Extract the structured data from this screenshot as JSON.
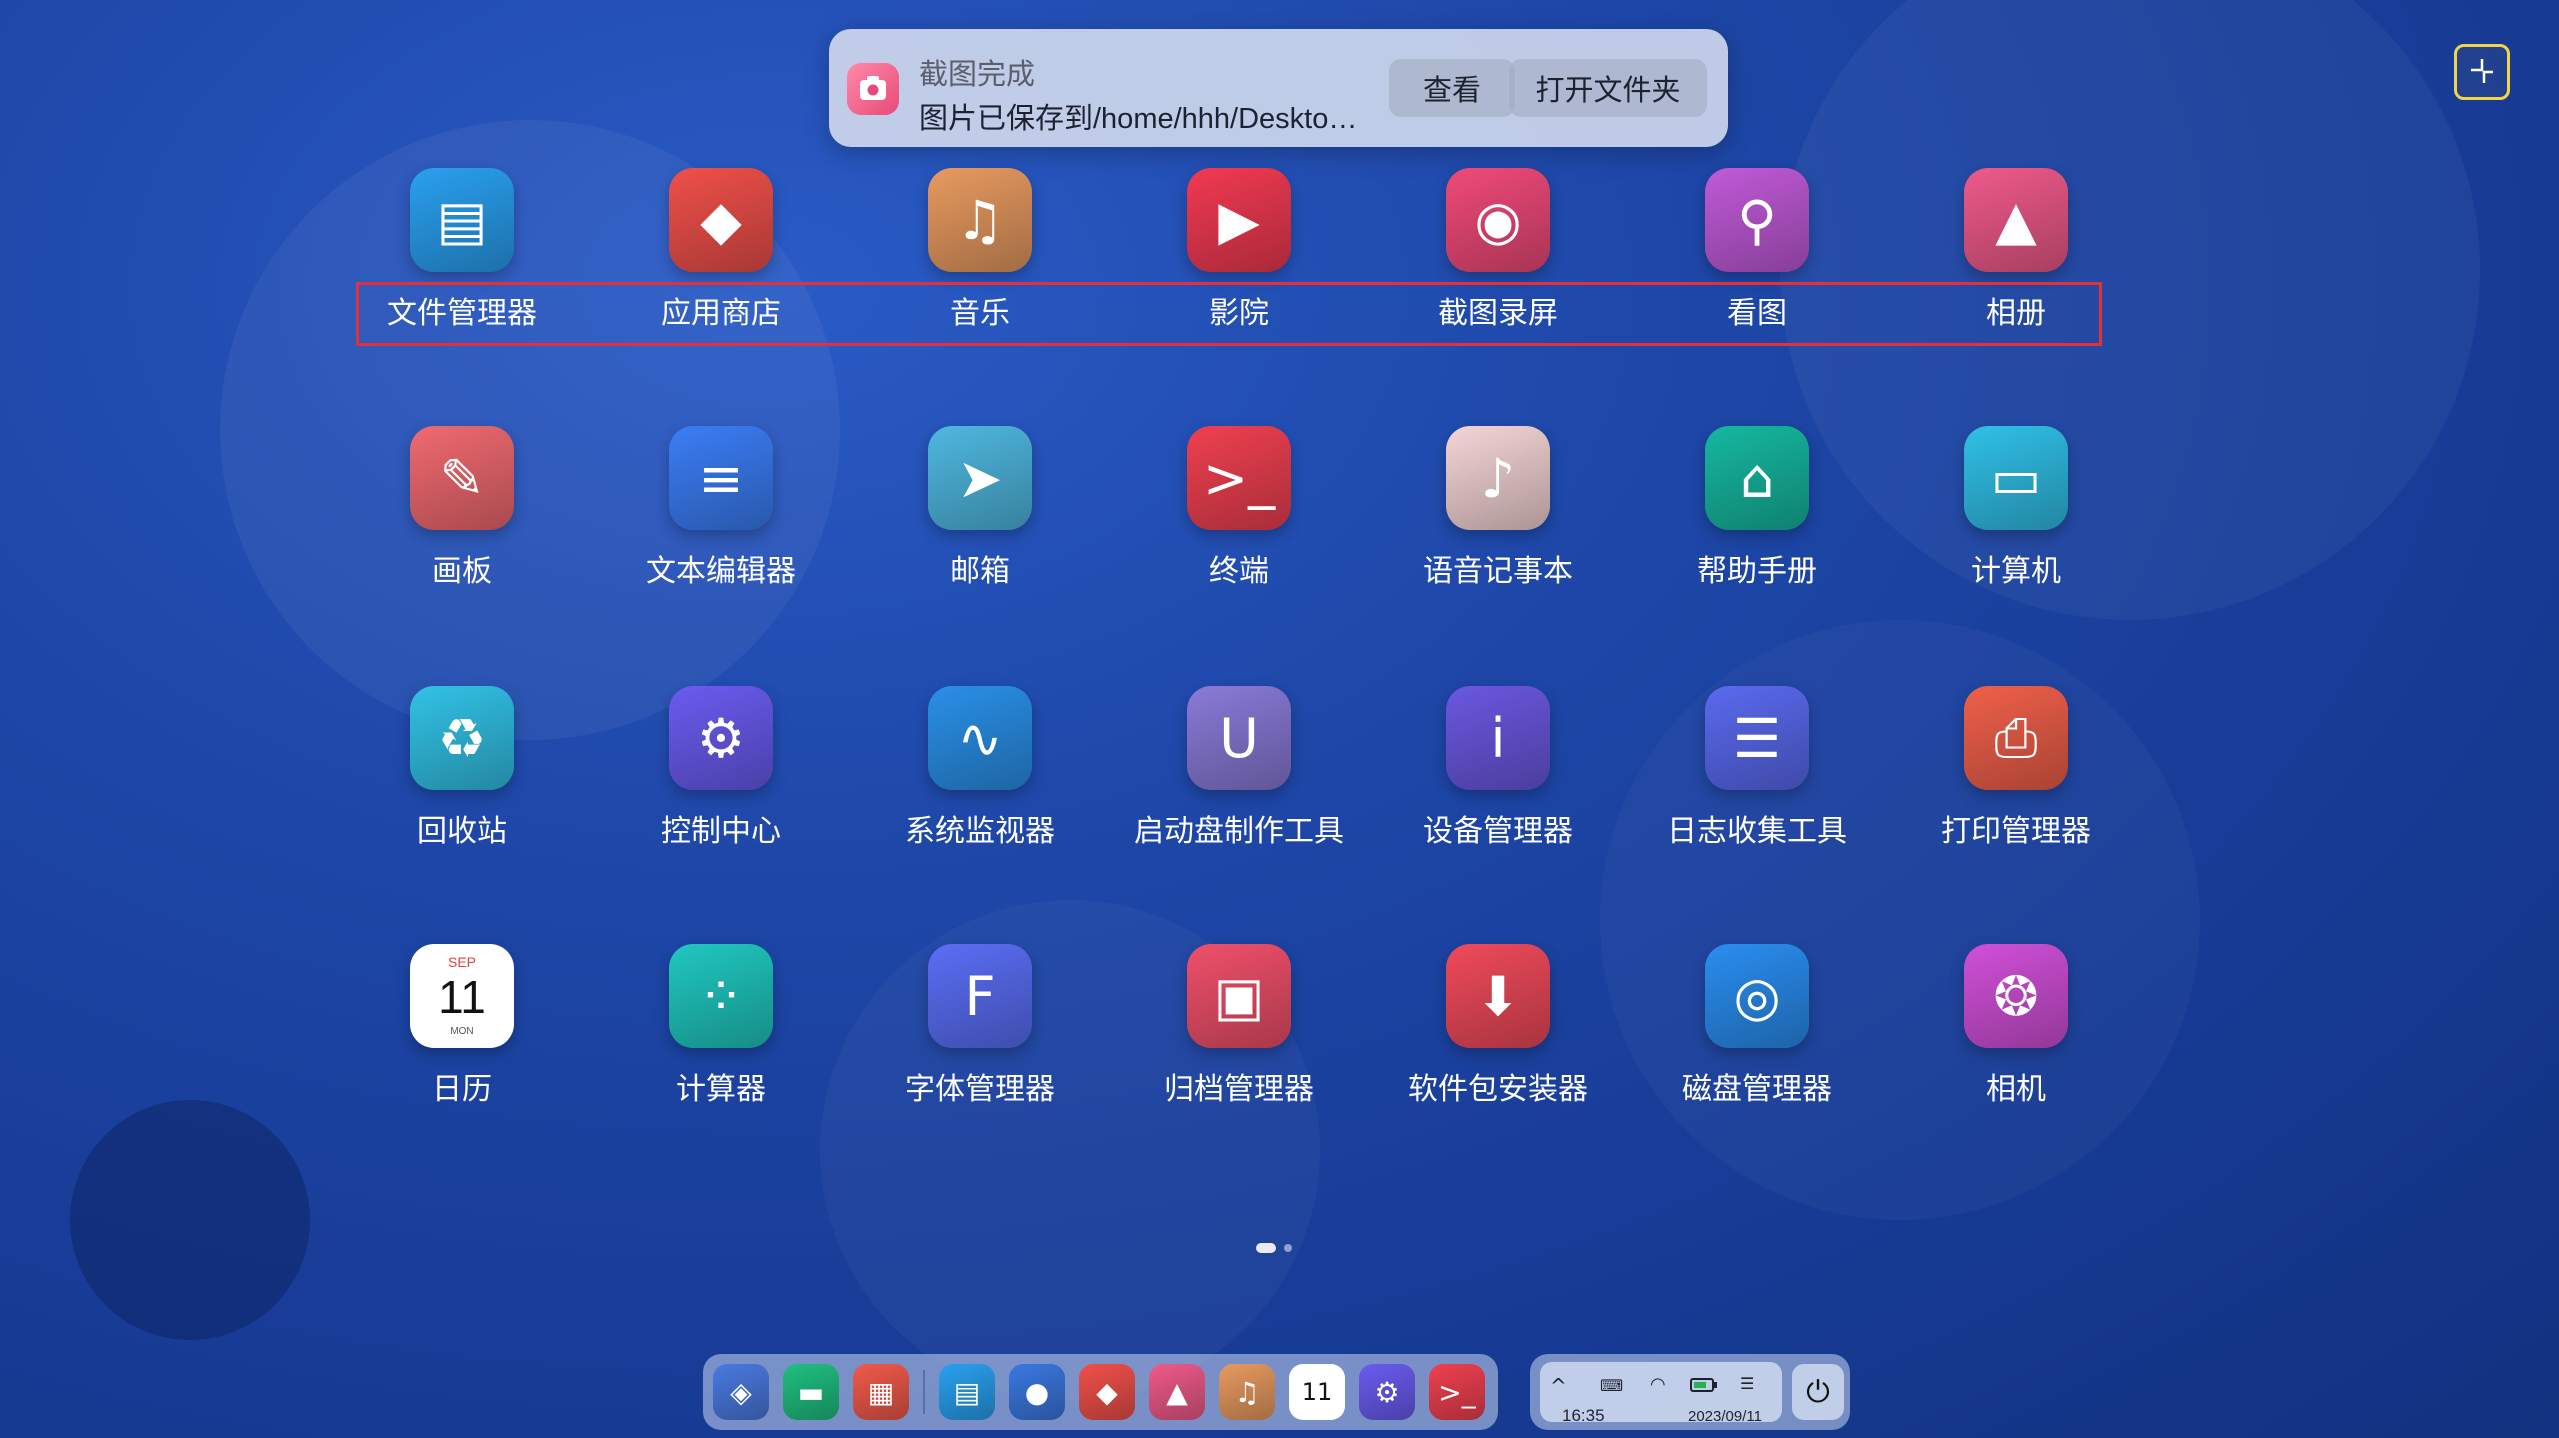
{
  "notification": {
    "title": "截图完成",
    "message": "图片已保存到/home/hhh/Deskto…",
    "view_label": "查看",
    "open_folder_label": "打开文件夹"
  },
  "apps": [
    {
      "label": "文件管理器",
      "icon": "folder-icon",
      "color": "#2aa0f0"
    },
    {
      "label": "应用商店",
      "icon": "store-tag-icon",
      "color": "#f0504a"
    },
    {
      "label": "音乐",
      "icon": "music-note-icon",
      "color": "#e89a60"
    },
    {
      "label": "影院",
      "icon": "play-icon",
      "color": "#f23a52"
    },
    {
      "label": "截图录屏",
      "icon": "camera-capture-icon",
      "color": "#f04a78"
    },
    {
      "label": "看图",
      "icon": "image-viewer-icon",
      "color": "#c05ad8"
    },
    {
      "label": "相册",
      "icon": "photo-album-icon",
      "color": "#ef5a8a"
    },
    {
      "label": "画板",
      "icon": "palette-icon",
      "color": "#f06a70"
    },
    {
      "label": "文本编辑器",
      "icon": "text-editor-icon",
      "color": "#3b7ef5"
    },
    {
      "label": "邮箱",
      "icon": "mail-send-icon",
      "color": "#4fb8e0"
    },
    {
      "label": "终端",
      "icon": "terminal-icon",
      "color": "#f04050"
    },
    {
      "label": "语音记事本",
      "icon": "voice-note-icon",
      "color": "#f5d5d5"
    },
    {
      "label": "帮助手册",
      "icon": "lighthouse-icon",
      "color": "#16b8a0"
    },
    {
      "label": "计算机",
      "icon": "computer-icon",
      "color": "#30c0e8"
    },
    {
      "label": "回收站",
      "icon": "recycle-icon",
      "color": "#32c2e6"
    },
    {
      "label": "控制中心",
      "icon": "gear-icon",
      "color": "#6a5cf0"
    },
    {
      "label": "系统监视器",
      "icon": "monitor-wave-icon",
      "color": "#2a90e8"
    },
    {
      "label": "启动盘制作工具",
      "icon": "usb-icon",
      "color": "#8a7ad8"
    },
    {
      "label": "设备管理器",
      "icon": "info-icon",
      "color": "#6a58e0"
    },
    {
      "label": "日志收集工具",
      "icon": "log-icon",
      "color": "#5a6af0"
    },
    {
      "label": "打印管理器",
      "icon": "printer-icon",
      "color": "#f0604a"
    },
    {
      "label": "日历",
      "icon": "calendar-icon",
      "color": "#ffffff"
    },
    {
      "label": "计算器",
      "icon": "calculator-icon",
      "color": "#20c8c0"
    },
    {
      "label": "字体管理器",
      "icon": "font-icon",
      "color": "#5a6ef5"
    },
    {
      "label": "归档管理器",
      "icon": "archive-icon",
      "color": "#f0506a"
    },
    {
      "label": "软件包安装器",
      "icon": "package-install-icon",
      "color": "#f04a5a"
    },
    {
      "label": "磁盘管理器",
      "icon": "disk-icon",
      "color": "#2a8ef0"
    },
    {
      "label": "相机",
      "icon": "camera-icon",
      "color": "#d050d8"
    }
  ],
  "calendar_icon": {
    "month": "SEP",
    "day": "11",
    "weekday": "MON"
  },
  "dock": {
    "items": [
      {
        "icon": "launcher-icon",
        "color": "#4a7ae0"
      },
      {
        "icon": "multitask-icon",
        "color": "#20c080"
      },
      {
        "icon": "workspace-icon",
        "color": "#f05a4a"
      },
      {
        "icon": "folder-icon",
        "color": "#2aa0f0"
      },
      {
        "icon": "browser-icon",
        "color": "#3a78e0"
      },
      {
        "icon": "store-tag-icon",
        "color": "#f0504a"
      },
      {
        "icon": "photo-album-icon",
        "color": "#ef5a8a"
      },
      {
        "icon": "music-note-icon",
        "color": "#e89a60"
      },
      {
        "icon": "calendar-icon",
        "color": "#ffffff"
      },
      {
        "icon": "gear-icon",
        "color": "#6a5cf0"
      },
      {
        "icon": "terminal-icon",
        "color": "#f04050"
      }
    ]
  },
  "tray": {
    "time": "16:35",
    "date": "2023/09/11"
  }
}
